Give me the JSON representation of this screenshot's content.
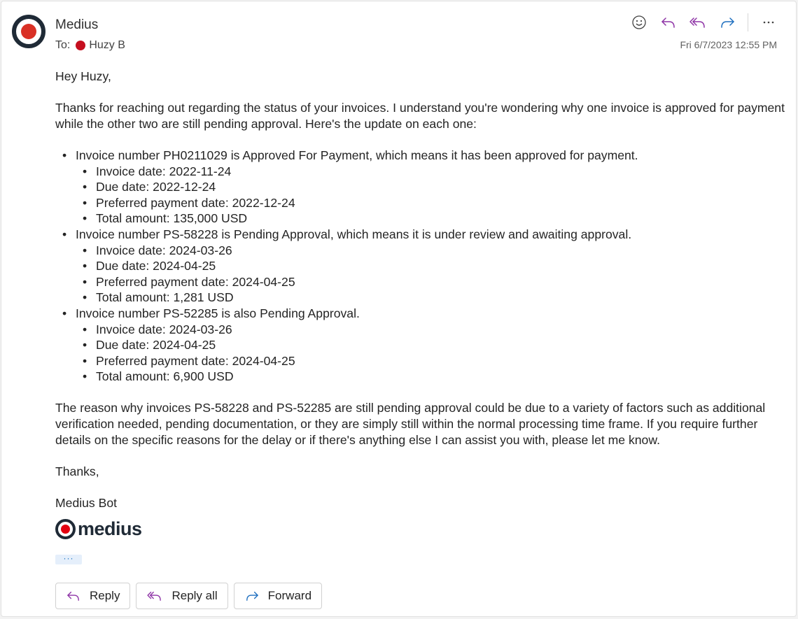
{
  "header": {
    "sender": "Medius",
    "to_label": "To:",
    "recipient": "Huzy B",
    "timestamp": "Fri 6/7/2023 12:55 PM",
    "toolbar": [
      {
        "name": "react",
        "icon": "emoji-icon"
      },
      {
        "name": "reply",
        "icon": "reply-icon"
      },
      {
        "name": "reply-all",
        "icon": "reply-all-icon"
      },
      {
        "name": "forward",
        "icon": "forward-icon"
      },
      {
        "name": "more",
        "icon": "more-icon",
        "label": "···"
      }
    ]
  },
  "colors": {
    "reply": "#8e34a6",
    "forward": "#1f6fbf",
    "brand_red": "#d93025",
    "brand_dark": "#1f2a36"
  },
  "body": {
    "greeting": "Hey Huzy,",
    "intro": "Thanks for reaching out regarding the status of your invoices. I understand you're wondering why one invoice is approved for payment while the other two are still pending approval. Here's the update on each one:",
    "invoices": [
      {
        "summary": "Invoice number PH0211029 is Approved For Payment, which means it has been approved for payment.",
        "details": [
          "Invoice date: 2022-11-24",
          "Due date: 2022-12-24",
          "Preferred payment date: 2022-12-24",
          "Total amount: 135,000 USD"
        ]
      },
      {
        "summary": "Invoice number PS-58228 is Pending Approval, which means it is under review and awaiting approval.",
        "details": [
          "Invoice date: 2024-03-26",
          "Due date: 2024-04-25",
          "Preferred payment date: 2024-04-25",
          "Total amount: 1,281 USD"
        ]
      },
      {
        "summary": "Invoice number PS-52285 is also Pending Approval.",
        "details": [
          "Invoice date: 2024-03-26",
          "Due date: 2024-04-25",
          "Preferred payment date: 2024-04-25",
          "Total amount: 6,900 USD"
        ]
      }
    ],
    "closing": "The reason why invoices PS-58228 and PS-52285 are still pending approval could be due to a variety of factors such as additional verification needed, pending documentation, or they are simply still within the normal processing time frame. If you require further details on the specific reasons for the delay or if there's anything else I can assist you with, please let me know.",
    "signoff": "Thanks,",
    "signature_name": "Medius Bot",
    "logo_text": "medius",
    "show_more_label": "···"
  },
  "actions": {
    "reply": "Reply",
    "reply_all": "Reply all",
    "forward": "Forward"
  }
}
